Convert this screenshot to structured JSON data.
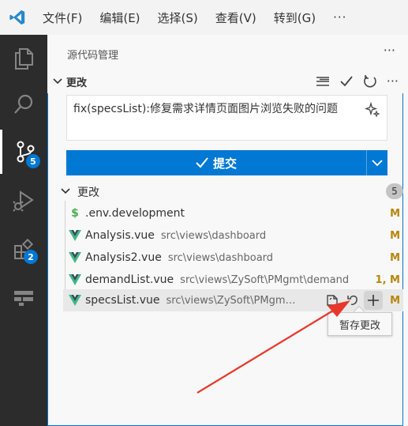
{
  "menu": [
    "文件(F)",
    "编辑(E)",
    "选择(S)",
    "查看(V)",
    "转到(G)"
  ],
  "menu_more": "···",
  "activity": {
    "scm_badge": "5",
    "ext_badge": "2"
  },
  "sidebar": {
    "title": "源代码管理",
    "more": "···",
    "section_label": "更改",
    "commit_message": "fix(specsList):修复需求详情页面图片浏览失败的问题",
    "commit_button": "提交",
    "changes_label": "更改",
    "changes_count": "5",
    "files": [
      {
        "icon": "$",
        "name": ".env.development",
        "path": "",
        "status": "M"
      },
      {
        "icon": "vue",
        "name": "Analysis.vue",
        "path": "src\\views\\dashboard",
        "status": "M"
      },
      {
        "icon": "vue",
        "name": "Analysis2.vue",
        "path": "src\\views\\dashboard",
        "status": "M"
      },
      {
        "icon": "vue",
        "name": "demandList.vue",
        "path": "src\\views\\ZySoft\\PMgmt\\demand",
        "status": "1, M"
      },
      {
        "icon": "vue",
        "name": "specsList.vue",
        "path": "src\\views\\ZySoft\\PMgmt\\s...",
        "status": "M"
      }
    ]
  },
  "tooltip": "暂存更改",
  "colors": {
    "accent": "#0078d4",
    "vue_green": "#41b883",
    "modified": "#b8860b",
    "arrow": "#e8382c"
  }
}
